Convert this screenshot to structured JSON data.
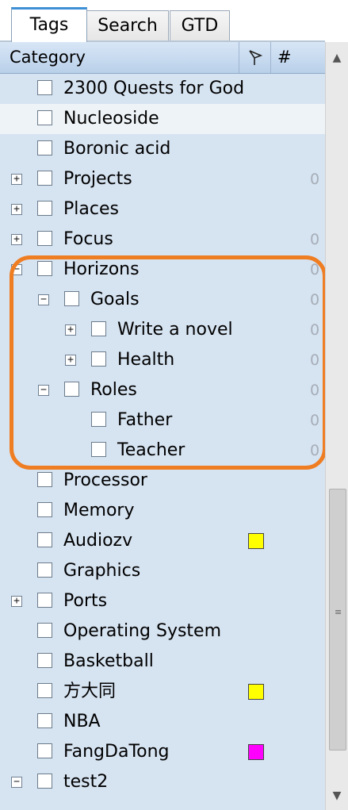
{
  "tabs": [
    {
      "label": "Tags",
      "active": true
    },
    {
      "label": "Search",
      "active": false
    },
    {
      "label": "GTD",
      "active": false
    }
  ],
  "header": {
    "category_label": "Category",
    "flag_icon": "flag-icon",
    "count_label": "#"
  },
  "tree": {
    "rows": [
      {
        "label": "2300 Quests for God",
        "level": 0,
        "expander": "none",
        "count": "",
        "color": ""
      },
      {
        "label": "Nucleoside",
        "level": 0,
        "expander": "none",
        "count": "",
        "color": ""
      },
      {
        "label": "Boronic acid",
        "level": 0,
        "expander": "none",
        "count": "",
        "color": ""
      },
      {
        "label": "Projects",
        "level": 0,
        "expander": "plus",
        "count": "0",
        "color": ""
      },
      {
        "label": "Places",
        "level": 0,
        "expander": "plus",
        "count": "",
        "color": ""
      },
      {
        "label": "Focus",
        "level": 0,
        "expander": "plus",
        "count": "0",
        "color": ""
      },
      {
        "label": "Horizons",
        "level": 0,
        "expander": "minus",
        "count": "0",
        "color": ""
      },
      {
        "label": "Goals",
        "level": 1,
        "expander": "minus",
        "count": "0",
        "color": ""
      },
      {
        "label": "Write a novel",
        "level": 2,
        "expander": "plus",
        "count": "0",
        "color": ""
      },
      {
        "label": "Health",
        "level": 2,
        "expander": "plus",
        "count": "0",
        "color": ""
      },
      {
        "label": "Roles",
        "level": 1,
        "expander": "minus",
        "count": "0",
        "color": ""
      },
      {
        "label": "Father",
        "level": 2,
        "expander": "none",
        "count": "0",
        "color": ""
      },
      {
        "label": "Teacher",
        "level": 2,
        "expander": "none",
        "count": "0",
        "color": ""
      },
      {
        "label": "Processor",
        "level": 0,
        "expander": "none",
        "count": "",
        "color": ""
      },
      {
        "label": "Memory",
        "level": 0,
        "expander": "none",
        "count": "",
        "color": ""
      },
      {
        "label": "Audiozv",
        "level": 0,
        "expander": "none",
        "count": "",
        "color": "#ffff00"
      },
      {
        "label": "Graphics",
        "level": 0,
        "expander": "none",
        "count": "",
        "color": ""
      },
      {
        "label": "Ports",
        "level": 0,
        "expander": "plus",
        "count": "",
        "color": ""
      },
      {
        "label": "Operating System",
        "level": 0,
        "expander": "none",
        "count": "",
        "color": ""
      },
      {
        "label": "Basketball",
        "level": 0,
        "expander": "none",
        "count": "",
        "color": ""
      },
      {
        "label": "方大同",
        "level": 0,
        "expander": "none",
        "count": "",
        "color": "#ffff00"
      },
      {
        "label": "NBA",
        "level": 0,
        "expander": "none",
        "count": "",
        "color": ""
      },
      {
        "label": "FangDaTong",
        "level": 0,
        "expander": "none",
        "count": "",
        "color": "#ff00ff"
      },
      {
        "label": "test2",
        "level": 0,
        "expander": "minus",
        "count": "",
        "color": ""
      }
    ]
  },
  "annotation_color": "#ef7d22",
  "scrollbar": {
    "up_icon": "arrow-up-icon",
    "down_icon": "arrow-down-icon",
    "grip_icon": "grip-icon"
  }
}
